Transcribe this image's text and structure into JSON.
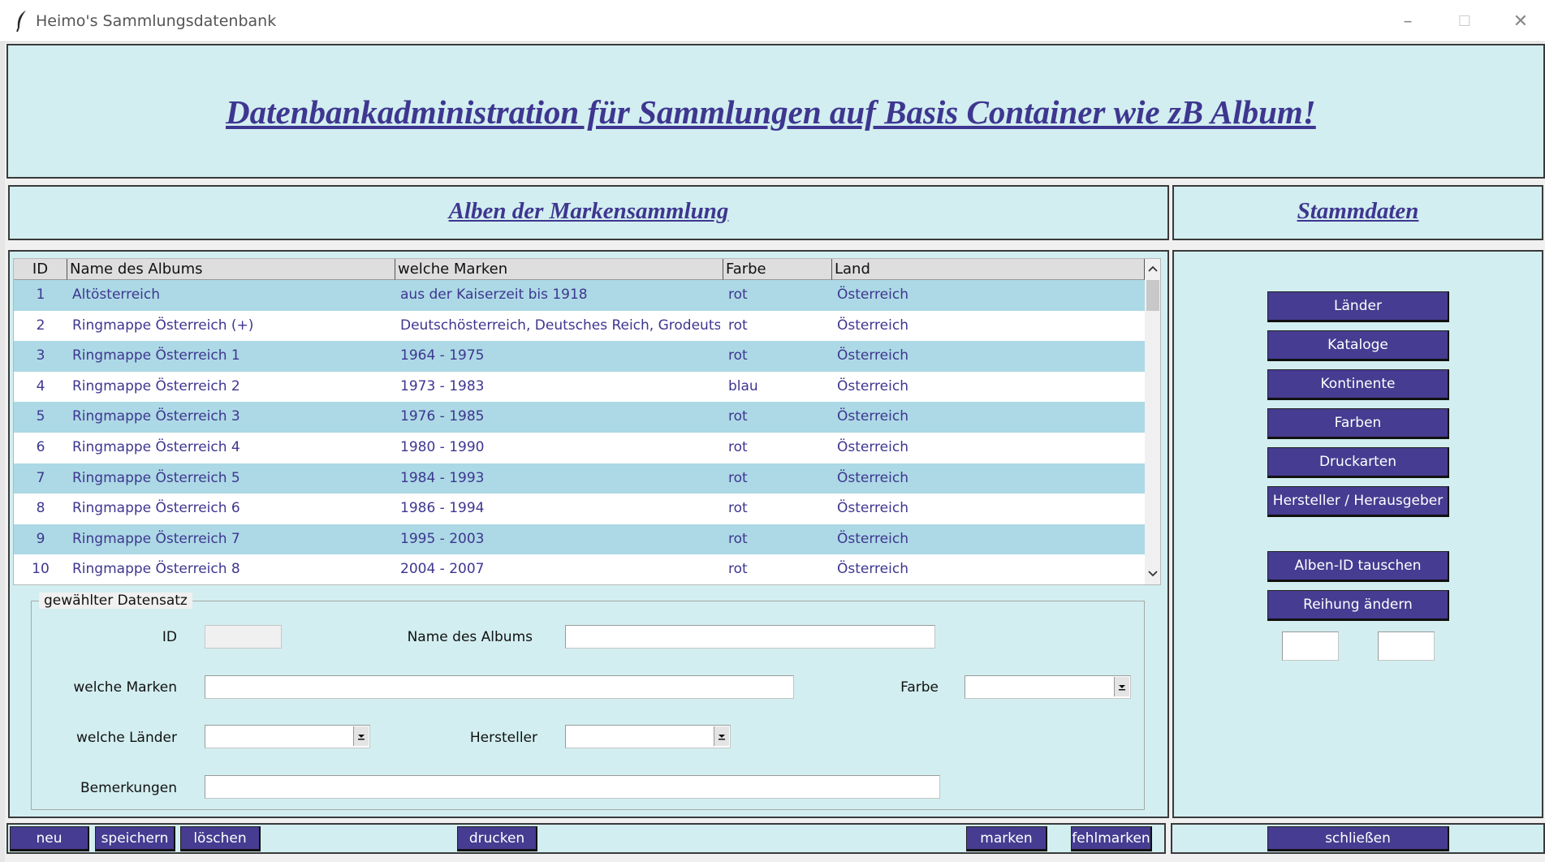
{
  "window": {
    "title": "Heimo's Sammlungsdatenbank",
    "controls": {
      "minimize": "–",
      "maximize": "☐",
      "close": "✕"
    }
  },
  "header": {
    "title": "Datenbankadministration für Sammlungen auf Basis Container wie zB Album!"
  },
  "albums_panel": {
    "title": "Alben der Markensammlung"
  },
  "stammdaten_panel": {
    "title": "Stammdaten"
  },
  "table": {
    "columns": [
      "ID",
      "Name des Albums",
      "welche Marken",
      "Farbe",
      "Land"
    ],
    "rows": [
      {
        "id": "1",
        "name": "Altösterreich",
        "marken": "aus der Kaiserzeit bis 1918",
        "farbe": "rot",
        "land": "Österreich"
      },
      {
        "id": "2",
        "name": "Ringmappe Österreich (+)",
        "marken": "Deutschösterreich, Deutsches Reich, Grodeutsche:",
        "farbe": "rot",
        "land": "Österreich"
      },
      {
        "id": "3",
        "name": "Ringmappe Österreich 1",
        "marken": "1964 - 1975",
        "farbe": "rot",
        "land": "Österreich"
      },
      {
        "id": "4",
        "name": "Ringmappe Österreich 2",
        "marken": "1973 - 1983",
        "farbe": "blau",
        "land": "Österreich"
      },
      {
        "id": "5",
        "name": "Ringmappe Österreich 3",
        "marken": "1976 - 1985",
        "farbe": "rot",
        "land": "Österreich"
      },
      {
        "id": "6",
        "name": "Ringmappe Österreich 4",
        "marken": "1980 - 1990",
        "farbe": "rot",
        "land": "Österreich"
      },
      {
        "id": "7",
        "name": "Ringmappe Österreich 5",
        "marken": "1984 - 1993",
        "farbe": "rot",
        "land": "Österreich"
      },
      {
        "id": "8",
        "name": "Ringmappe Österreich 6",
        "marken": "1986 - 1994",
        "farbe": "rot",
        "land": "Österreich"
      },
      {
        "id": "9",
        "name": "Ringmappe Österreich 7",
        "marken": "1995 - 2003",
        "farbe": "rot",
        "land": "Österreich"
      },
      {
        "id": "10",
        "name": "Ringmappe Österreich 8",
        "marken": "2004 - 2007",
        "farbe": "rot",
        "land": "Österreich"
      }
    ]
  },
  "form": {
    "legend": "gewählter Datensatz",
    "labels": {
      "id": "ID",
      "name": "Name des Albums",
      "marken": "welche Marken",
      "farbe": "Farbe",
      "laender": "welche Länder",
      "hersteller": "Hersteller",
      "bemerkungen": "Bemerkungen"
    },
    "values": {
      "id": "",
      "name": "",
      "marken": "",
      "farbe": "",
      "laender": "",
      "hersteller": "",
      "bemerkungen": ""
    }
  },
  "stammdaten_buttons": [
    "Länder",
    "Kataloge",
    "Kontinente",
    "Farben",
    "Druckarten",
    "Hersteller / Herausgeber"
  ],
  "tools": {
    "swap_label": "Alben-ID tauschen",
    "reorder_label": "Reihung ändern",
    "input_a": "",
    "input_b": ""
  },
  "bottom_bar": {
    "neu": "neu",
    "speichern": "speichern",
    "loeschen": "löschen",
    "drucken": "drucken",
    "marken": "marken",
    "fehlmarken": "fehlmarken",
    "schliessen": "schließen"
  },
  "colors": {
    "panel_bg": "#d2eef0",
    "accent": "#463c91",
    "heading_text": "#3e3690",
    "row_highlight": "#acd9e5"
  }
}
